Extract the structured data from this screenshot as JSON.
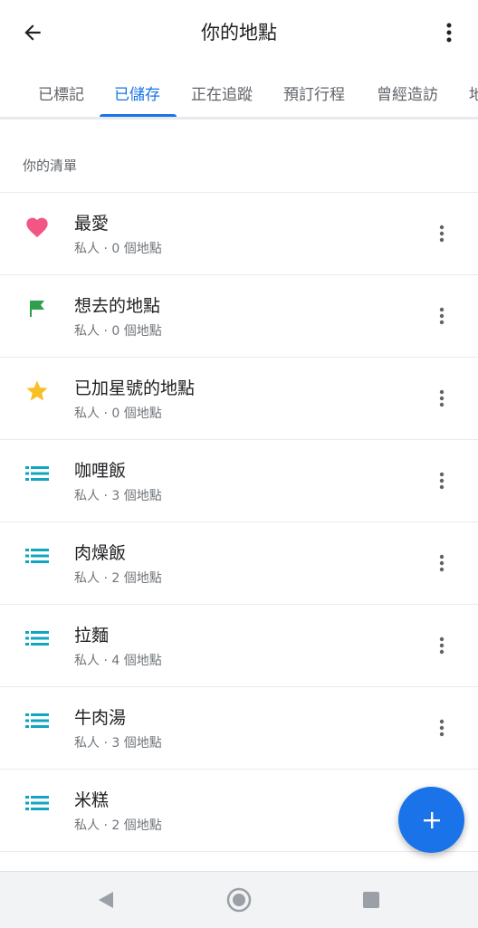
{
  "header": {
    "title": "你的地點",
    "back_icon": "arrow-back-icon",
    "more_icon": "more-vert-icon"
  },
  "tabs": [
    {
      "label": "已標記",
      "active": false
    },
    {
      "label": "已儲存",
      "active": true
    },
    {
      "label": "正在追蹤",
      "active": false
    },
    {
      "label": "預訂行程",
      "active": false
    },
    {
      "label": "曾經造訪",
      "active": false
    },
    {
      "label": "地",
      "active": false
    }
  ],
  "section": {
    "title": "你的清單"
  },
  "lists": [
    {
      "name": "最愛",
      "meta": "私人 · 0 個地點",
      "icon": "heart-icon",
      "icon_color": "#f25682"
    },
    {
      "name": "想去的地點",
      "meta": "私人 · 0 個地點",
      "icon": "flag-icon",
      "icon_color": "#2e9e4f"
    },
    {
      "name": "已加星號的地點",
      "meta": "私人 · 0 個地點",
      "icon": "star-icon",
      "icon_color": "#f6c026"
    },
    {
      "name": "咖哩飯",
      "meta": "私人 · 3 個地點",
      "icon": "list-icon",
      "icon_color": "#12a4c0"
    },
    {
      "name": "肉燥飯",
      "meta": "私人 · 2 個地點",
      "icon": "list-icon",
      "icon_color": "#12a4c0"
    },
    {
      "name": "拉麵",
      "meta": "私人 · 4 個地點",
      "icon": "list-icon",
      "icon_color": "#12a4c0"
    },
    {
      "name": "牛肉湯",
      "meta": "私人 · 3 個地點",
      "icon": "list-icon",
      "icon_color": "#12a4c0"
    },
    {
      "name": "米糕",
      "meta": "私人 · 2 個地點",
      "icon": "list-icon",
      "icon_color": "#12a4c0"
    }
  ],
  "fab": {
    "icon": "add-icon",
    "color": "#1a73e8"
  },
  "colors": {
    "accent": "#1a73e8",
    "secondary_text": "#70757a",
    "divider": "#e8eaed"
  }
}
